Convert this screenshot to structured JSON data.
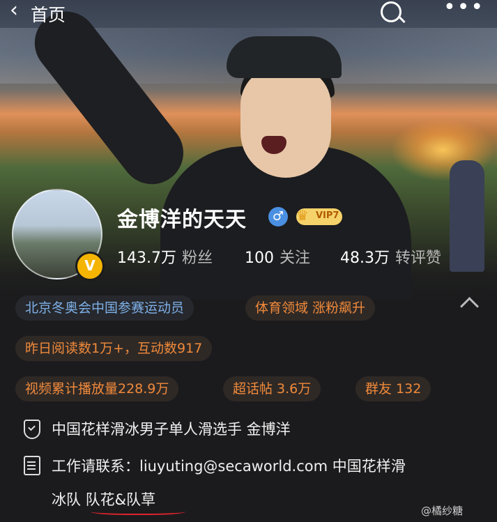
{
  "topbar": {
    "back_label": "首页",
    "back_icon": "chevron-left-icon",
    "search_icon": "search-icon",
    "more_icon": "more-icon"
  },
  "profile": {
    "name": "金博洋的天天",
    "gender_symbol": "♂",
    "vip_badge": "VIP7",
    "verified_symbol": "V",
    "stats": [
      {
        "num": "143.7万",
        "label": "粉丝"
      },
      {
        "num": "100",
        "label": "关注"
      },
      {
        "num": "48.3万",
        "label": "转评赞"
      }
    ]
  },
  "tags": {
    "row1": [
      "北京冬奥会中国参赛运动员",
      "体育领域 涨粉飙升"
    ],
    "row2": [
      "昨日阅读数1万+，互动数917"
    ],
    "row3": [
      "视频累计播放量228.9万",
      "超话帖 3.6万",
      "群友 132"
    ]
  },
  "info": {
    "verification": "中国花样滑冰男子单人滑选手 金博洋",
    "contact_line1": "工作请联系：liuyuting@secaworld.com  中国花样滑",
    "contact_line2_part1": "冰队 ",
    "contact_line2_part2": "队花&队草"
  },
  "watermark": "@橘纱糖",
  "colors": {
    "accent_blue": "#7fb0e8",
    "accent_orange": "#f08a3b",
    "background": "#1b1b1d"
  }
}
